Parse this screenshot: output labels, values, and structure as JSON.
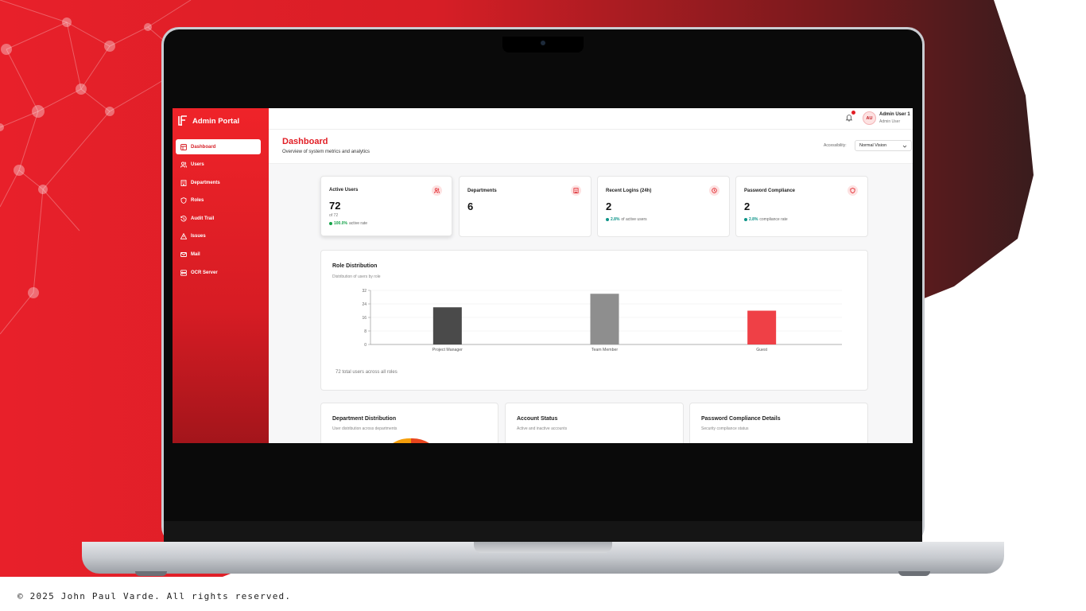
{
  "copyright": "© 2025 John Paul Varde. All rights reserved.",
  "sidebar": {
    "logo": "brand-logo-icon",
    "title": "Admin Portal",
    "items": [
      {
        "label": "Dashboard",
        "icon": "dashboard-icon",
        "active": true
      },
      {
        "label": "Users",
        "icon": "users-icon"
      },
      {
        "label": "Departments",
        "icon": "building-icon"
      },
      {
        "label": "Roles",
        "icon": "shield-icon"
      },
      {
        "label": "Audit Trail",
        "icon": "history-icon"
      },
      {
        "label": "Issues",
        "icon": "warning-icon"
      },
      {
        "label": "Mail",
        "icon": "mail-icon"
      },
      {
        "label": "OCR Server",
        "icon": "server-icon"
      }
    ]
  },
  "topbar": {
    "avatar_initials": "AU",
    "user_name": "Admin User 1",
    "user_role": "Admin User",
    "has_notification": true
  },
  "header": {
    "title": "Dashboard",
    "subtitle": "Overview of system metrics and analytics",
    "accessibility_label": "Accessibility:",
    "accessibility_value": "Normal Vision"
  },
  "stats": [
    {
      "title": "Active Users",
      "value": "72",
      "of": "of 72",
      "pct": "100.0%",
      "foot": "active rate",
      "dot_color": "#16a34a",
      "icon": "users-icon"
    },
    {
      "title": "Departments",
      "value": "6",
      "icon": "building-icon"
    },
    {
      "title": "Recent Logins (24h)",
      "value": "2",
      "pct": "2.8%",
      "foot": "of active users",
      "dot_color": "#0d9488",
      "icon": "clock-icon"
    },
    {
      "title": "Password Compliance",
      "value": "2",
      "pct": "2.8%",
      "foot": "compliance rate",
      "dot_color": "#0d9488",
      "icon": "shield-icon"
    }
  ],
  "role_chart": {
    "title": "Role Distribution",
    "subtitle": "Distribution of users by role",
    "footer": "72 total users across all roles"
  },
  "chart_data": {
    "type": "bar",
    "categories": [
      "Project Manager",
      "Team Member",
      "Guest"
    ],
    "values": [
      22,
      30,
      20
    ],
    "colors": [
      "#4a4a4a",
      "#8e8e8e",
      "#ef4046"
    ],
    "yticks": [
      "0",
      "8",
      "16",
      "24",
      "32"
    ],
    "ylim": [
      0,
      32
    ],
    "grid": true
  },
  "bottom_cards": [
    {
      "title": "Department Distribution",
      "subtitle": "User distribution across departments"
    },
    {
      "title": "Account Status",
      "subtitle": "Active and inactive accounts"
    },
    {
      "title": "Password Compliance Details",
      "subtitle": "Security compliance status"
    }
  ]
}
